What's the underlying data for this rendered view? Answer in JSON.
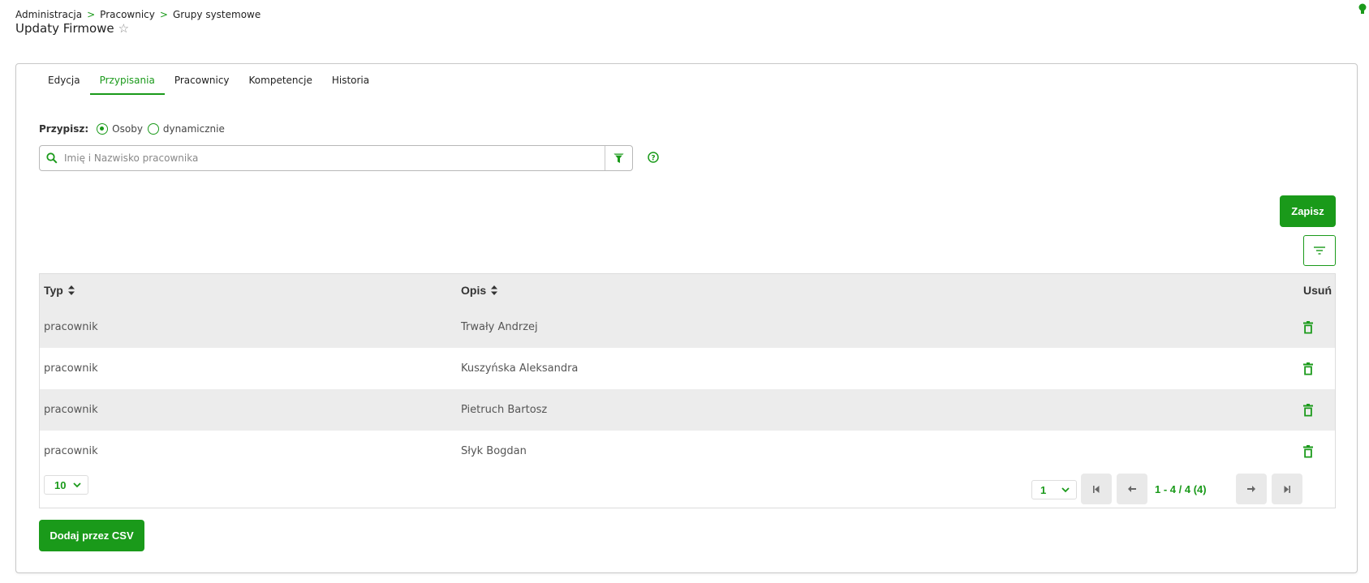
{
  "breadcrumb": {
    "items": [
      "Administracja",
      "Pracownicy",
      "Grupy systemowe"
    ],
    "separator": ">"
  },
  "page": {
    "title": "Updaty Firmowe"
  },
  "tabs": [
    {
      "label": "Edycja",
      "active": false
    },
    {
      "label": "Przypisania",
      "active": true
    },
    {
      "label": "Pracownicy",
      "active": false
    },
    {
      "label": "Kompetencje",
      "active": false
    },
    {
      "label": "Historia",
      "active": false
    }
  ],
  "assign": {
    "label": "Przypisz:",
    "options": [
      "Osoby",
      "dynamicznie"
    ],
    "selected": "Osoby"
  },
  "search": {
    "placeholder": "Imię i Nazwisko pracownika",
    "value": ""
  },
  "toolbar": {
    "save_label": "Zapisz"
  },
  "table": {
    "headers": {
      "typ": "Typ",
      "opis": "Opis",
      "usun": "Usuń"
    },
    "rows": [
      {
        "typ": "pracownik",
        "opis": "Trwały Andrzej"
      },
      {
        "typ": "pracownik",
        "opis": "Kuszyńska Aleksandra"
      },
      {
        "typ": "pracownik",
        "opis": "Pietruch Bartosz"
      },
      {
        "typ": "pracownik",
        "opis": "Słyk Bogdan"
      }
    ]
  },
  "pagination": {
    "per_page": "10",
    "page": "1",
    "info": "1 - 4 / 4 (4)"
  },
  "footer": {
    "csv_label": "Dodaj przez CSV"
  },
  "colors": {
    "accent": "#1a9a1a",
    "row_alt": "#ececec"
  }
}
